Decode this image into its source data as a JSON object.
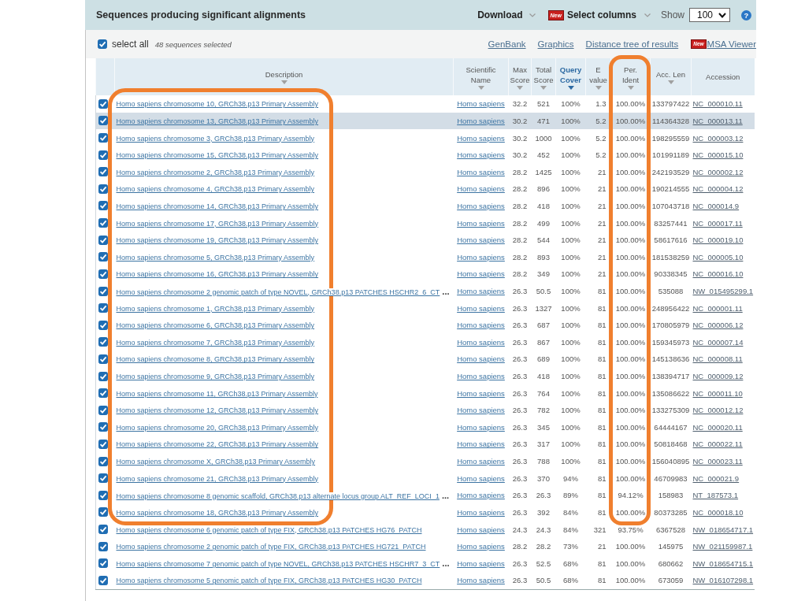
{
  "header": {
    "title": "Sequences producing significant alignments",
    "download": "Download",
    "select_columns": {
      "badge": "New",
      "label": "Select columns"
    },
    "show": {
      "label": "Show",
      "value": "100"
    },
    "help": "?"
  },
  "toolbar": {
    "select_all": {
      "label": "select all",
      "checked": true
    },
    "count": "48 sequences selected",
    "links": [
      {
        "label": "GenBank"
      },
      {
        "label": "Graphics"
      },
      {
        "label": "Distance tree of results"
      },
      {
        "label": "MSA Viewer",
        "badge": "New"
      }
    ]
  },
  "table": {
    "columns": [
      {
        "label": "Description",
        "sortable": true,
        "sorted": false
      },
      {
        "label": "Scientific Name",
        "sortable": true,
        "sorted": false
      },
      {
        "label": "Max Score",
        "sortable": true,
        "sorted": false
      },
      {
        "label": "Total Score",
        "sortable": true,
        "sorted": false
      },
      {
        "label": "Query Cover",
        "sortable": true,
        "sorted": true
      },
      {
        "label": "E value",
        "sortable": true,
        "sorted": false
      },
      {
        "label": "Per. Ident",
        "sortable": true,
        "sorted": false
      },
      {
        "label": "Acc. Len",
        "sortable": true,
        "sorted": false
      },
      {
        "label": "Accession",
        "sortable": false,
        "sorted": false
      }
    ],
    "rows": [
      {
        "checked": true,
        "hovered": false,
        "description": "Homo sapiens chromosome 10, GRCh38.p13 Primary Assembly",
        "organism": "Homo sapiens",
        "max_score": "32.2",
        "total_score": "521",
        "query_cover": "100%",
        "e_value": "1.3",
        "per_ident": "100.00%",
        "acc_len": "133797422",
        "accession": "NC_000010.11"
      },
      {
        "checked": true,
        "hovered": true,
        "description": "Homo sapiens chromosome 13, GRCh38.p13 Primary Assembly",
        "organism": "Homo sapiens",
        "max_score": "30.2",
        "total_score": "471",
        "query_cover": "100%",
        "e_value": "5.2",
        "per_ident": "100.00%",
        "acc_len": "114364328",
        "accession": "NC_000013.11"
      },
      {
        "checked": true,
        "hovered": false,
        "description": "Homo sapiens chromosome 3, GRCh38.p13 Primary Assembly",
        "organism": "Homo sapiens",
        "max_score": "30.2",
        "total_score": "1000",
        "query_cover": "100%",
        "e_value": "5.2",
        "per_ident": "100.00%",
        "acc_len": "198295559",
        "accession": "NC_000003.12"
      },
      {
        "checked": true,
        "hovered": false,
        "description": "Homo sapiens chromosome 15, GRCh38.p13 Primary Assembly",
        "organism": "Homo sapiens",
        "max_score": "30.2",
        "total_score": "452",
        "query_cover": "100%",
        "e_value": "5.2",
        "per_ident": "100.00%",
        "acc_len": "101991189",
        "accession": "NC_000015.10"
      },
      {
        "checked": true,
        "hovered": false,
        "description": "Homo sapiens chromosome 2, GRCh38.p13 Primary Assembly",
        "organism": "Homo sapiens",
        "max_score": "28.2",
        "total_score": "1425",
        "query_cover": "100%",
        "e_value": "21",
        "per_ident": "100.00%",
        "acc_len": "242193529",
        "accession": "NC_000002.12"
      },
      {
        "checked": true,
        "hovered": false,
        "description": "Homo sapiens chromosome 4, GRCh38.p13 Primary Assembly",
        "organism": "Homo sapiens",
        "max_score": "28.2",
        "total_score": "896",
        "query_cover": "100%",
        "e_value": "21",
        "per_ident": "100.00%",
        "acc_len": "190214555",
        "accession": "NC_000004.12"
      },
      {
        "checked": true,
        "hovered": false,
        "description": "Homo sapiens chromosome 14, GRCh38.p13 Primary Assembly",
        "organism": "Homo sapiens",
        "max_score": "28.2",
        "total_score": "418",
        "query_cover": "100%",
        "e_value": "21",
        "per_ident": "100.00%",
        "acc_len": "107043718",
        "accession": "NC_000014.9"
      },
      {
        "checked": true,
        "hovered": false,
        "description": "Homo sapiens chromosome 17, GRCh38.p13 Primary Assembly",
        "organism": "Homo sapiens",
        "max_score": "28.2",
        "total_score": "499",
        "query_cover": "100%",
        "e_value": "21",
        "per_ident": "100.00%",
        "acc_len": "83257441",
        "accession": "NC_000017.11"
      },
      {
        "checked": true,
        "hovered": false,
        "description": "Homo sapiens chromosome 19, GRCh38.p13 Primary Assembly",
        "organism": "Homo sapiens",
        "max_score": "28.2",
        "total_score": "544",
        "query_cover": "100%",
        "e_value": "21",
        "per_ident": "100.00%",
        "acc_len": "58617616",
        "accession": "NC_000019.10"
      },
      {
        "checked": true,
        "hovered": false,
        "description": "Homo sapiens chromosome 5, GRCh38.p13 Primary Assembly",
        "organism": "Homo sapiens",
        "max_score": "28.2",
        "total_score": "893",
        "query_cover": "100%",
        "e_value": "21",
        "per_ident": "100.00%",
        "acc_len": "181538259",
        "accession": "NC_000005.10"
      },
      {
        "checked": true,
        "hovered": false,
        "description": "Homo sapiens chromosome 16, GRCh38.p13 Primary Assembly",
        "organism": "Homo sapiens",
        "max_score": "28.2",
        "total_score": "349",
        "query_cover": "100%",
        "e_value": "21",
        "per_ident": "100.00%",
        "acc_len": "90338345",
        "accession": "NC_000016.10"
      },
      {
        "checked": true,
        "hovered": false,
        "description": "Homo sapiens chromosome 2 genomic patch of type NOVEL, GRCh38.p13 PATCHES HSCHR2_6_CT",
        "ellipsis": "...",
        "organism": "Homo sapiens",
        "max_score": "26.3",
        "total_score": "50.5",
        "query_cover": "100%",
        "e_value": "81",
        "per_ident": "100.00%",
        "acc_len": "535088",
        "accession": "NW_015495299.1"
      },
      {
        "checked": true,
        "hovered": false,
        "description": "Homo sapiens chromosome 1, GRCh38.p13 Primary Assembly",
        "organism": "Homo sapiens",
        "max_score": "26.3",
        "total_score": "1327",
        "query_cover": "100%",
        "e_value": "81",
        "per_ident": "100.00%",
        "acc_len": "248956422",
        "accession": "NC_000001.11"
      },
      {
        "checked": true,
        "hovered": false,
        "description": "Homo sapiens chromosome 6, GRCh38.p13 Primary Assembly",
        "organism": "Homo sapiens",
        "max_score": "26.3",
        "total_score": "687",
        "query_cover": "100%",
        "e_value": "81",
        "per_ident": "100.00%",
        "acc_len": "170805979",
        "accession": "NC_000006.12"
      },
      {
        "checked": true,
        "hovered": false,
        "description": "Homo sapiens chromosome 7, GRCh38.p13 Primary Assembly",
        "organism": "Homo sapiens",
        "max_score": "26.3",
        "total_score": "867",
        "query_cover": "100%",
        "e_value": "81",
        "per_ident": "100.00%",
        "acc_len": "159345973",
        "accession": "NC_000007.14"
      },
      {
        "checked": true,
        "hovered": false,
        "description": "Homo sapiens chromosome 8, GRCh38.p13 Primary Assembly",
        "organism": "Homo sapiens",
        "max_score": "26.3",
        "total_score": "689",
        "query_cover": "100%",
        "e_value": "81",
        "per_ident": "100.00%",
        "acc_len": "145138636",
        "accession": "NC_000008.11"
      },
      {
        "checked": true,
        "hovered": false,
        "description": "Homo sapiens chromosome 9, GRCh38.p13 Primary Assembly",
        "organism": "Homo sapiens",
        "max_score": "26.3",
        "total_score": "418",
        "query_cover": "100%",
        "e_value": "81",
        "per_ident": "100.00%",
        "acc_len": "138394717",
        "accession": "NC_000009.12"
      },
      {
        "checked": true,
        "hovered": false,
        "description": "Homo sapiens chromosome 11, GRCh38.p13 Primary Assembly",
        "organism": "Homo sapiens",
        "max_score": "26.3",
        "total_score": "764",
        "query_cover": "100%",
        "e_value": "81",
        "per_ident": "100.00%",
        "acc_len": "135086622",
        "accession": "NC_000011.10"
      },
      {
        "checked": true,
        "hovered": false,
        "description": "Homo sapiens chromosome 12, GRCh38.p13 Primary Assembly",
        "organism": "Homo sapiens",
        "max_score": "26.3",
        "total_score": "782",
        "query_cover": "100%",
        "e_value": "81",
        "per_ident": "100.00%",
        "acc_len": "133275309",
        "accession": "NC_000012.12"
      },
      {
        "checked": true,
        "hovered": false,
        "description": "Homo sapiens chromosome 20, GRCh38.p13 Primary Assembly",
        "organism": "Homo sapiens",
        "max_score": "26.3",
        "total_score": "345",
        "query_cover": "100%",
        "e_value": "81",
        "per_ident": "100.00%",
        "acc_len": "64444167",
        "accession": "NC_000020.11"
      },
      {
        "checked": true,
        "hovered": false,
        "description": "Homo sapiens chromosome 22, GRCh38.p13 Primary Assembly",
        "organism": "Homo sapiens",
        "max_score": "26.3",
        "total_score": "317",
        "query_cover": "100%",
        "e_value": "81",
        "per_ident": "100.00%",
        "acc_len": "50818468",
        "accession": "NC_000022.11"
      },
      {
        "checked": true,
        "hovered": false,
        "description": "Homo sapiens chromosome X, GRCh38.p13 Primary Assembly",
        "organism": "Homo sapiens",
        "max_score": "26.3",
        "total_score": "788",
        "query_cover": "100%",
        "e_value": "81",
        "per_ident": "100.00%",
        "acc_len": "156040895",
        "accession": "NC_000023.11"
      },
      {
        "checked": true,
        "hovered": false,
        "description": "Homo sapiens chromosome 21, GRCh38.p13 Primary Assembly",
        "organism": "Homo sapiens",
        "max_score": "26.3",
        "total_score": "370",
        "query_cover": "94%",
        "e_value": "81",
        "per_ident": "100.00%",
        "acc_len": "46709983",
        "accession": "NC_000021.9"
      },
      {
        "checked": true,
        "hovered": false,
        "description": "Homo sapiens chromosome 8 genomic scaffold, GRCh38.p13 alternate locus group ALT_REF_LOCI_1",
        "ellipsis": "...",
        "organism": "Homo sapiens",
        "max_score": "26.3",
        "total_score": "26.3",
        "query_cover": "89%",
        "e_value": "81",
        "per_ident": "94.12%",
        "acc_len": "158983",
        "accession": "NT_187573.1"
      },
      {
        "checked": true,
        "hovered": false,
        "description": "Homo sapiens chromosome 18, GRCh38.p13 Primary Assembly",
        "organism": "Homo sapiens",
        "max_score": "26.3",
        "total_score": "392",
        "query_cover": "84%",
        "e_value": "81",
        "per_ident": "100.00%",
        "acc_len": "80373285",
        "accession": "NC_000018.10"
      },
      {
        "checked": true,
        "hovered": false,
        "description": "Homo sapiens chromosome 6 genomic patch of type FIX, GRCh38.p13 PATCHES HG76_PATCH",
        "organism": "Homo sapiens",
        "max_score": "24.3",
        "total_score": "24.3",
        "query_cover": "84%",
        "e_value": "321",
        "per_ident": "93.75%",
        "acc_len": "6367528",
        "accession": "NW_018654717.1"
      },
      {
        "checked": true,
        "hovered": false,
        "description": "Homo sapiens chromosome 2 genomic patch of type FIX, GRCh38.p13 PATCHES HG721_PATCH",
        "organism": "Homo sapiens",
        "max_score": "28.2",
        "total_score": "28.2",
        "query_cover": "73%",
        "e_value": "21",
        "per_ident": "100.00%",
        "acc_len": "145975",
        "accession": "NW_021159987.1"
      },
      {
        "checked": true,
        "hovered": false,
        "description": "Homo sapiens chromosome 7 genomic patch of type NOVEL, GRCh38.p13 PATCHES HSCHR7_3_CT",
        "ellipsis": "...",
        "organism": "Homo sapiens",
        "max_score": "26.3",
        "total_score": "52.5",
        "query_cover": "68%",
        "e_value": "81",
        "per_ident": "100.00%",
        "acc_len": "680662",
        "accession": "NW_018654715.1"
      },
      {
        "checked": true,
        "hovered": false,
        "description": "Homo sapiens chromosome 5 genomic patch of type FIX, GRCh38.p13 PATCHES HG30_PATCH",
        "organism": "Homo sapiens",
        "max_score": "26.3",
        "total_score": "50.5",
        "query_cover": "68%",
        "e_value": "81",
        "per_ident": "100.00%",
        "acc_len": "673059",
        "accession": "NW_016107298.1"
      }
    ]
  },
  "annotations": [
    {
      "kind": "outline"
    },
    {
      "kind": "outline"
    }
  ]
}
